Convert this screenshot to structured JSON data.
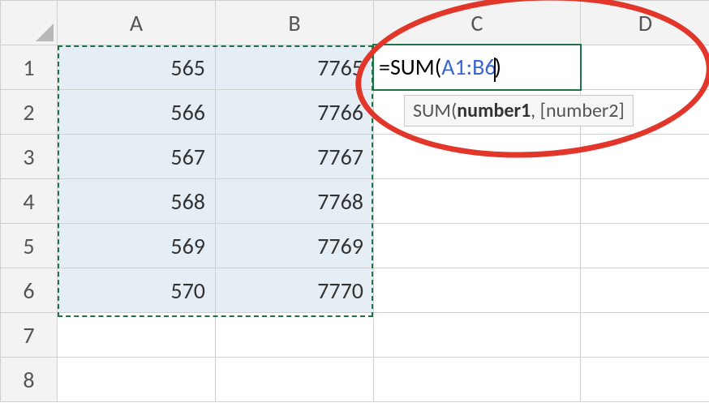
{
  "columns": [
    "A",
    "B",
    "C",
    "D"
  ],
  "row_headers": [
    "1",
    "2",
    "3",
    "4",
    "5",
    "6",
    "7",
    "8"
  ],
  "grid": {
    "A": [
      "565",
      "566",
      "567",
      "568",
      "569",
      "570",
      "",
      ""
    ],
    "B": [
      "7765",
      "7766",
      "7767",
      "7768",
      "7769",
      "7770",
      "",
      ""
    ],
    "C": [
      "",
      "",
      "",
      "",
      "",
      "",
      "",
      ""
    ],
    "D": [
      "",
      "",
      "",
      "",
      "",
      "",
      "",
      ""
    ]
  },
  "selection_range": "A1:B6",
  "active_cell": "C1",
  "formula": {
    "prefix": "=SUM(",
    "ref": "A1:B6",
    "suffix": ")"
  },
  "tooltip": {
    "name": "SUM",
    "arg1": "number1",
    "rest": ", [number2]"
  },
  "annotation": {
    "type": "ellipse",
    "color": "#e3362b"
  }
}
